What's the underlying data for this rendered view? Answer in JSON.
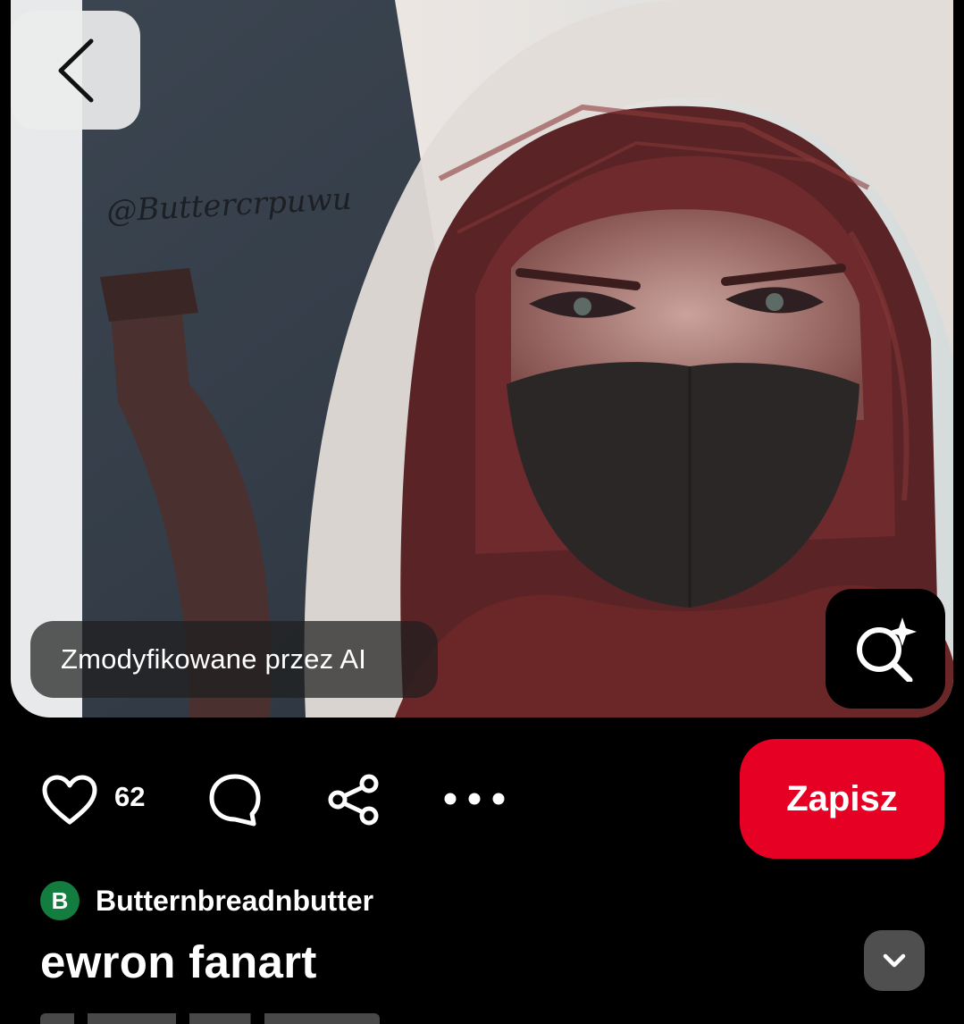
{
  "image": {
    "watermark": "@Buttercrpuwu",
    "ai_badge": "Zmodyfikowane przez AI"
  },
  "navigation": {
    "back_icon": "chevron-left-icon",
    "lens_icon": "visual-search-sparkle-icon"
  },
  "actions": {
    "like_icon": "heart-outline-icon",
    "like_count": "62",
    "comment_icon": "comment-bubble-icon",
    "share_icon": "share-icon",
    "more_icon": "more-horizontal-icon",
    "save_label": "Zapisz",
    "save_color": "#e60023"
  },
  "author": {
    "avatar_letter": "B",
    "avatar_color": "#137d3f",
    "name": "Butternbreadnbutter"
  },
  "pin": {
    "title": "ewron fanart",
    "expand_icon": "chevron-down-icon"
  }
}
